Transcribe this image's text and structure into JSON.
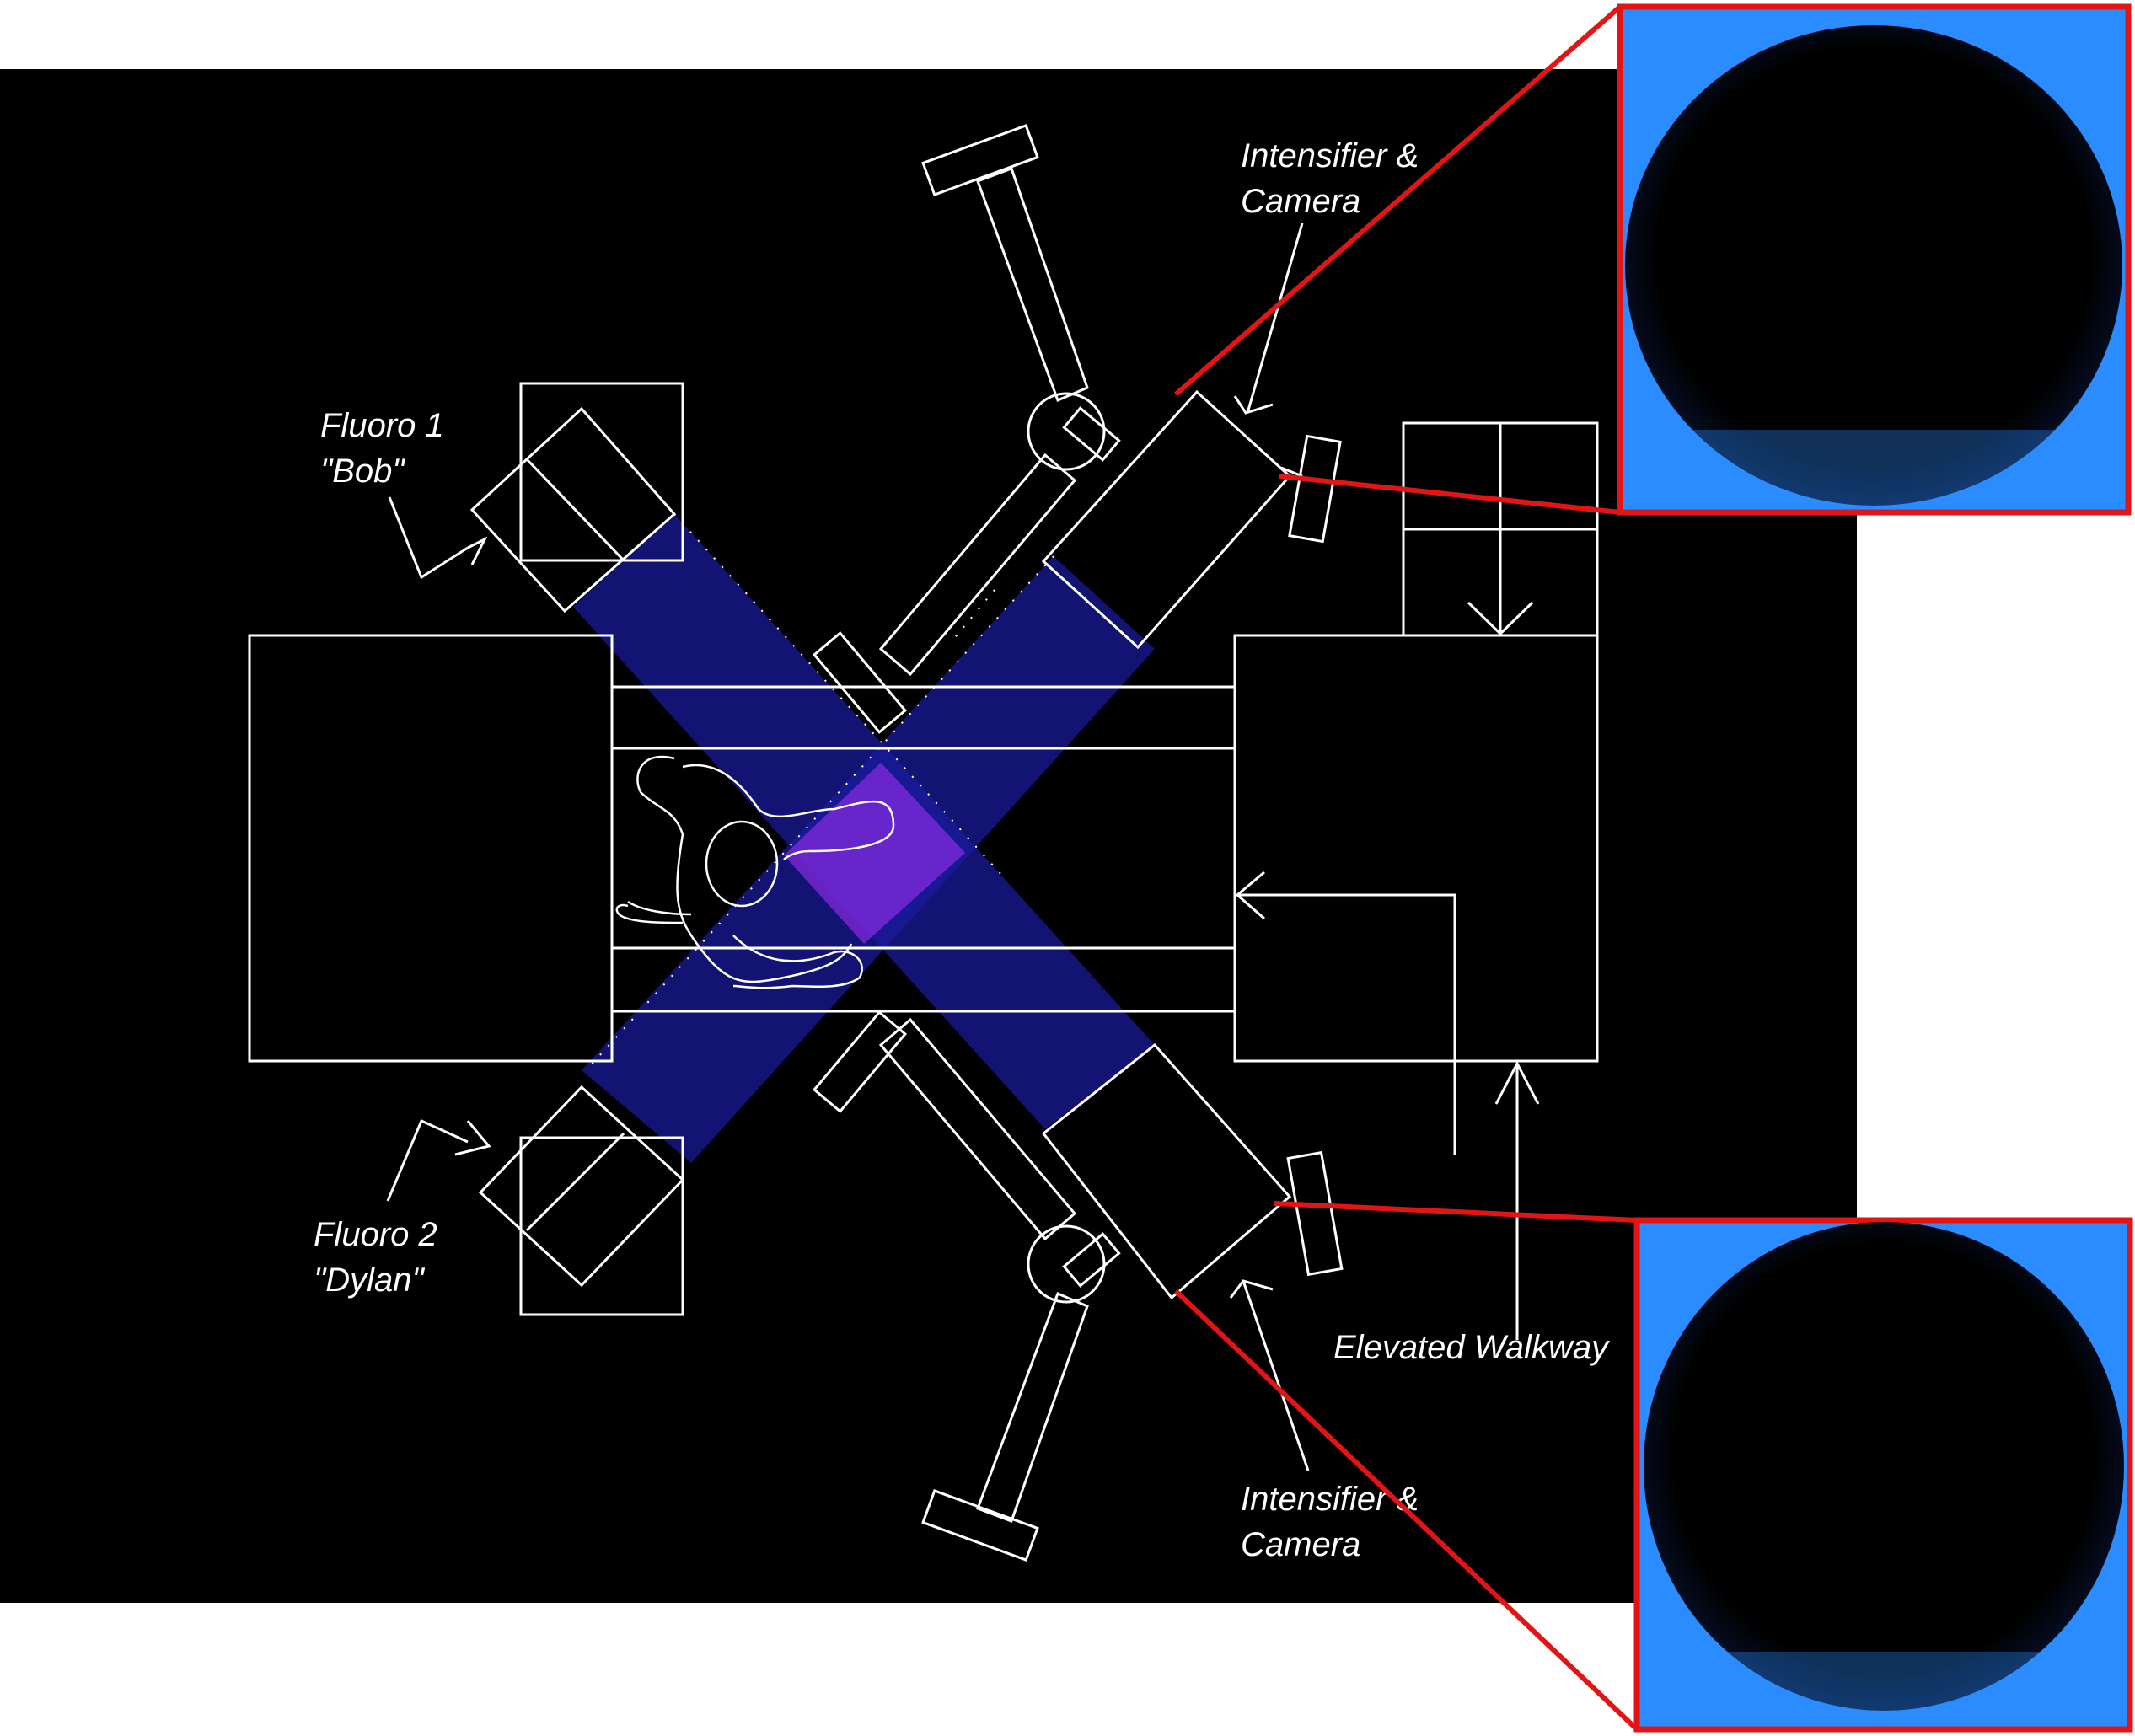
{
  "labels": {
    "fluoro1": [
      "Fluoro 1",
      "\"Bob\""
    ],
    "fluoro2": [
      "Fluoro 2",
      "\"Dylan\""
    ],
    "intensifier_top": [
      "Intensifier &",
      "Camera"
    ],
    "intensifier_bottom": [
      "Intensifier &",
      "Camera"
    ],
    "walkway": "Elevated Walkway"
  },
  "colors": {
    "background": "#000000",
    "lines": "#ffffff",
    "beam": "#1a1aa0",
    "overlap": "#8a2be2",
    "callout": "#e31414",
    "inset_glow": "#2a8cff"
  }
}
